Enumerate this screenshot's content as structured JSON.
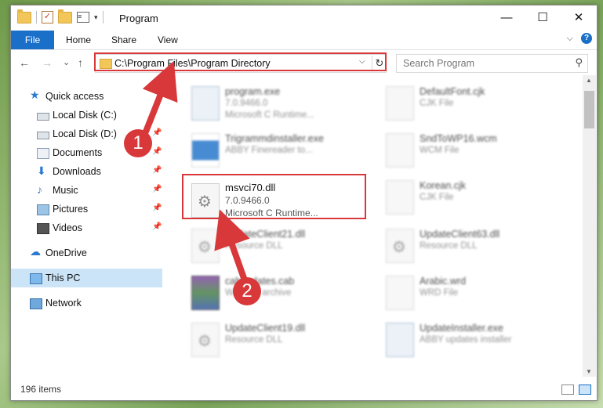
{
  "window": {
    "title": "Program",
    "controls": {
      "minimize": "—",
      "maximize": "☐",
      "close": "✕"
    }
  },
  "qat": {
    "check": "✓",
    "props": "≡",
    "arrow": "▾"
  },
  "ribbon": {
    "tabs": [
      {
        "label": "File"
      },
      {
        "label": "Home"
      },
      {
        "label": "Share"
      },
      {
        "label": "View"
      }
    ],
    "collapse": "⌵",
    "help": "?"
  },
  "nav": {
    "back": "←",
    "forward": "→",
    "recent": "⌄",
    "up": "↑",
    "address": "C:\\Program Files\\Program Directory",
    "address_dropdown": "⌵",
    "refresh": "↻",
    "search_placeholder": "Search Program",
    "search_icon": "⚲"
  },
  "sidebar": {
    "items": [
      {
        "label": "Quick access",
        "icon": "star-icon",
        "glyph": "★",
        "pinned": false
      },
      {
        "label": "Local Disk (C:)",
        "icon": "disk-icon",
        "glyph": "",
        "pinned": false
      },
      {
        "label": "Local Disk (D:)",
        "icon": "disk-icon",
        "glyph": "",
        "pinned": true
      },
      {
        "label": "Documents",
        "icon": "documents-icon",
        "glyph": "",
        "pinned": true
      },
      {
        "label": "Downloads",
        "icon": "download-icon",
        "glyph": "⬇",
        "pinned": true
      },
      {
        "label": "Music",
        "icon": "music-icon",
        "glyph": "♪",
        "pinned": true
      },
      {
        "label": "Pictures",
        "icon": "pictures-icon",
        "glyph": "",
        "pinned": true
      },
      {
        "label": "Videos",
        "icon": "videos-icon",
        "glyph": "",
        "pinned": true
      },
      {
        "label": "OneDrive",
        "icon": "cloud-icon",
        "glyph": "☁",
        "pinned": false
      },
      {
        "label": "This PC",
        "icon": "computer-icon",
        "glyph": "",
        "pinned": false,
        "selected": true
      },
      {
        "label": "Network",
        "icon": "network-icon",
        "glyph": "",
        "pinned": false
      }
    ],
    "pin_glyph": "📌"
  },
  "files": [
    {
      "name": "program.exe",
      "version": "7.0.9466.0",
      "desc": "Microsoft C Runtime...",
      "type": "exe"
    },
    {
      "name": "DefaultFont.cjk",
      "version": "CJK File",
      "desc": "",
      "type": "blank"
    },
    {
      "name": "Trigrammdinstaller.exe",
      "version": "ABBY Finereader to...",
      "desc": "",
      "type": "win"
    },
    {
      "name": "SndToWP16.wcm",
      "version": "WCM File",
      "desc": "",
      "type": "blank"
    },
    {
      "name": "msvci70.dll",
      "version": "7.0.9466.0",
      "desc": "Microsoft C Runtime...",
      "type": "dll",
      "focus": true
    },
    {
      "name": "Korean.cjk",
      "version": "CJK File",
      "desc": "",
      "type": "blank"
    },
    {
      "name": "UpdateClient21.dll",
      "version": "Resource DLL",
      "desc": "",
      "type": "dll"
    },
    {
      "name": "UpdateClient63.dll",
      "version": "Resource DLL",
      "desc": "",
      "type": "dll"
    },
    {
      "name": "cabupdates.cab",
      "version": "WinRAR archive",
      "desc": "",
      "type": "cab"
    },
    {
      "name": "Arabic.wrd",
      "version": "WRD File",
      "desc": "",
      "type": "blank"
    },
    {
      "name": "UpdateClient19.dll",
      "version": "Resource DLL",
      "desc": "",
      "type": "dll"
    },
    {
      "name": "UpdateInstaller.exe",
      "version": "ABBY updates installer",
      "desc": "",
      "type": "blank"
    }
  ],
  "status": {
    "count": "196 items"
  },
  "annotations": {
    "marker1": "1",
    "marker2": "2",
    "color": "#d8383a"
  },
  "colors": {
    "accent": "#1a6fc9",
    "selection": "#cce4f7",
    "highlight": "#d8383a"
  }
}
